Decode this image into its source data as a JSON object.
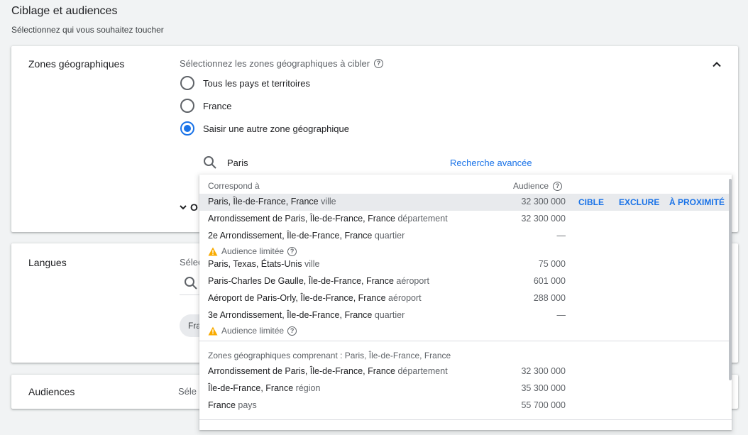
{
  "page": {
    "title": "Ciblage et audiences",
    "subtitle": "Sélectionnez qui vous souhaitez toucher"
  },
  "geo": {
    "label": "Zones géographiques",
    "prompt": "Sélectionnez les zones géographiques à cibler",
    "options": [
      {
        "label": "Tous les pays et territoires",
        "checked": false
      },
      {
        "label": "France",
        "checked": false
      },
      {
        "label": "Saisir une autre zone géographique",
        "checked": true
      }
    ],
    "search_value": "Paris",
    "advanced_search": "Recherche avancée",
    "hidden_section_initial": "O"
  },
  "languages": {
    "label": "Langues",
    "prompt": "Sélec",
    "chip": "Fra"
  },
  "audiences": {
    "label": "Audiences",
    "prompt": "Séle"
  },
  "dropdown": {
    "col_match": "Correspond à",
    "col_audience": "Audience",
    "actions": {
      "target": "CIBLE",
      "exclude": "EXCLURE",
      "nearby": "À PROXIMITÉ"
    },
    "warning_text": "Audience limitée",
    "results": [
      {
        "name": "Paris, Île-de-France, France",
        "type": "ville",
        "audience": "32 300 000"
      },
      {
        "name": "Arrondissement de Paris, Île-de-France, France",
        "type": "département",
        "audience": "32 300 000"
      },
      {
        "name": "2e Arrondissement, Île-de-France, France",
        "type": "quartier",
        "audience": "—"
      },
      {
        "name": "Paris, Texas, États-Unis",
        "type": "ville",
        "audience": "75 000"
      },
      {
        "name": "Paris-Charles De Gaulle, Île-de-France, France",
        "type": "aéroport",
        "audience": "601 000"
      },
      {
        "name": "Aéroport de Paris-Orly, Île-de-France, France",
        "type": "aéroport",
        "audience": "288 000"
      },
      {
        "name": "3e Arrondissement, Île-de-France, France",
        "type": "quartier",
        "audience": "—"
      }
    ],
    "section_title": "Zones géographiques comprenant : Paris, Île-de-France, France",
    "containing": [
      {
        "name": "Arrondissement de Paris, Île-de-France, France",
        "type": "département",
        "audience": "32 300 000"
      },
      {
        "name": "Île-de-France, France",
        "type": "région",
        "audience": "35 300 000"
      },
      {
        "name": "France",
        "type": "pays",
        "audience": "55 700 000"
      }
    ]
  },
  "colors": {
    "accent": "#1a73e8",
    "warning": "#f9ab00",
    "highlight": "#e8eaed"
  }
}
